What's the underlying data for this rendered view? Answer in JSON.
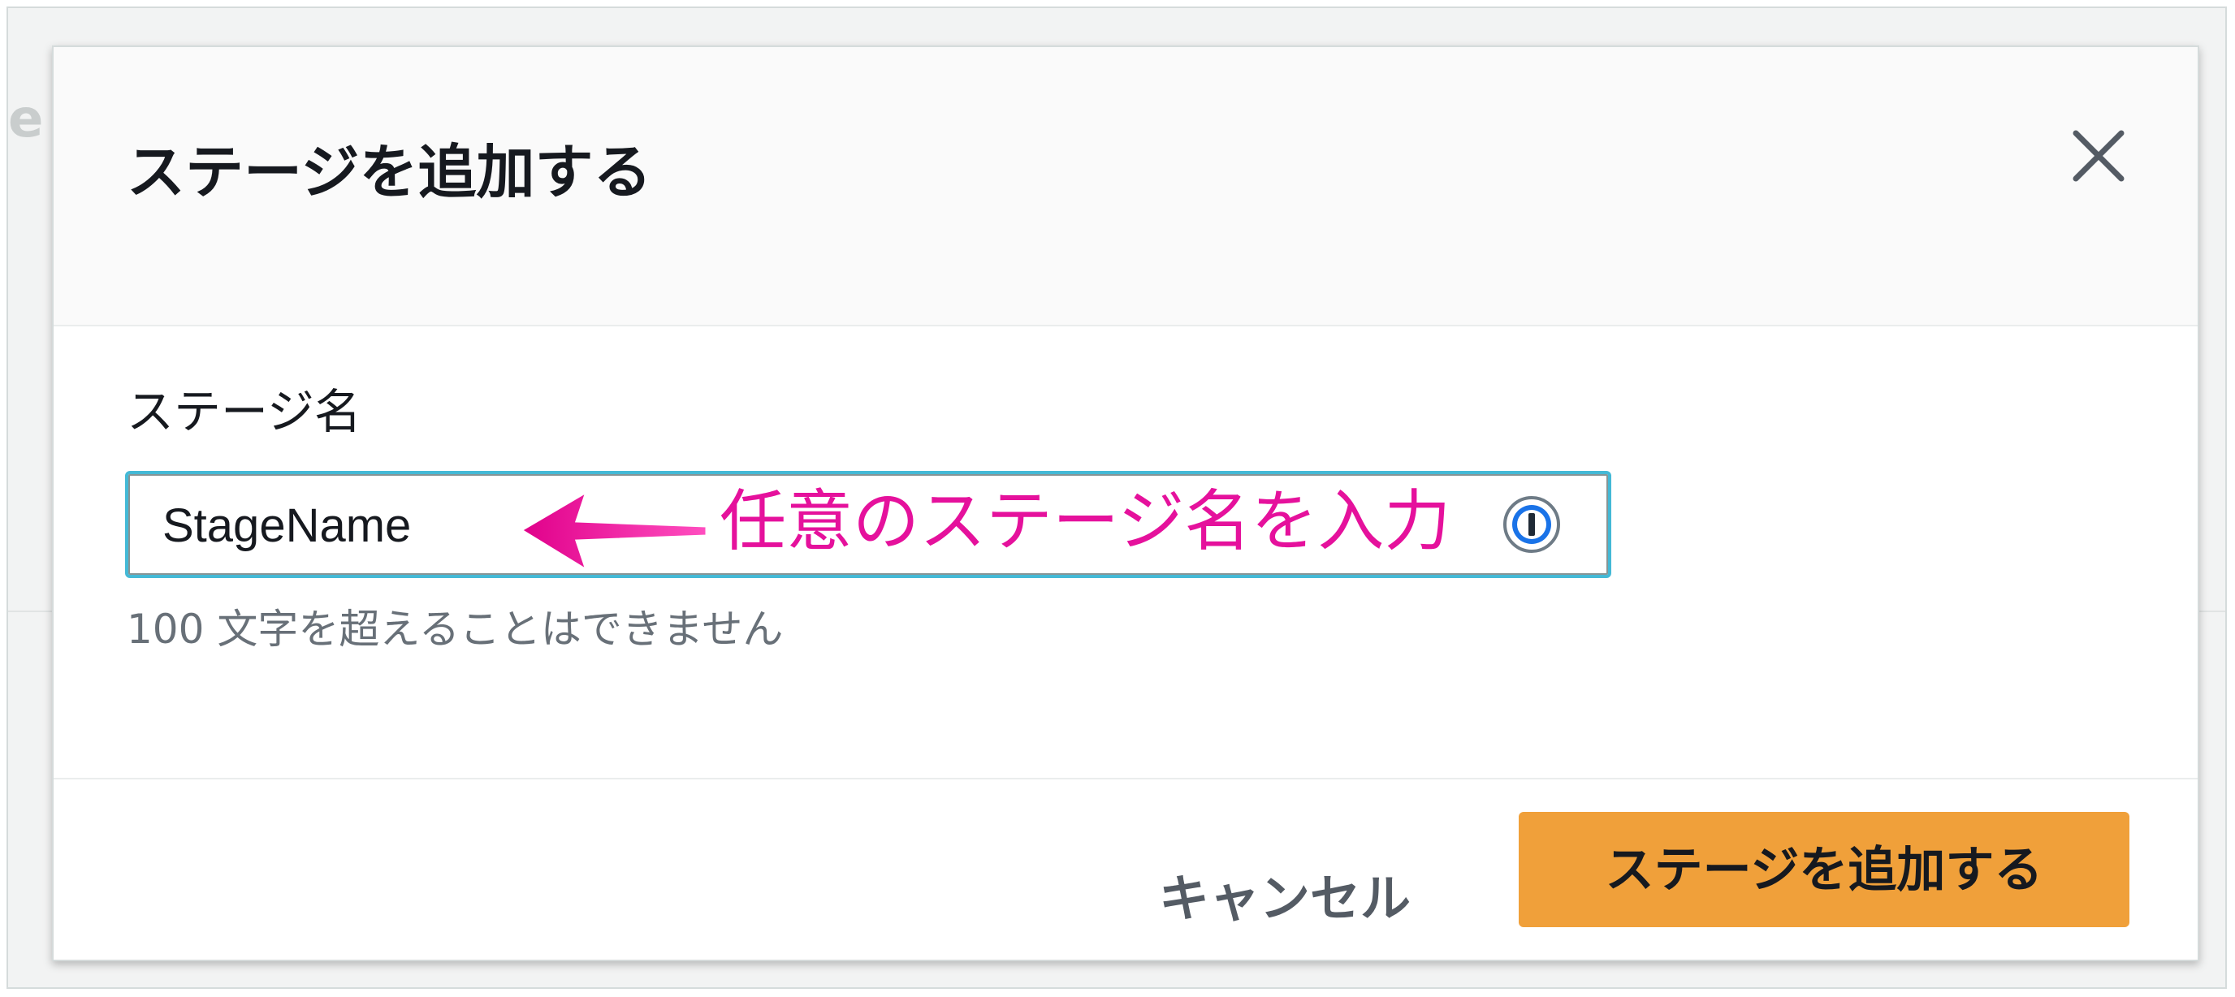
{
  "background": {
    "partial_text": "e"
  },
  "modal": {
    "title": "ステージを追加する",
    "close_icon": "close-icon",
    "field": {
      "label": "ステージ名",
      "value": "StageName",
      "hint": "100 文字を超えることはできません",
      "password_manager_icon": "password-manager-icon"
    },
    "annotation": {
      "text": "任意のステージ名を入力",
      "color": "#e5119c",
      "arrow_icon": "arrow-left-icon"
    },
    "footer": {
      "cancel_label": "キャンセル",
      "submit_label": "ステージを追加する"
    }
  },
  "colors": {
    "primary_button": "#f0a03a",
    "input_focus_border": "#44b9d6",
    "title_text": "#16191f",
    "hint_text": "#687078"
  }
}
